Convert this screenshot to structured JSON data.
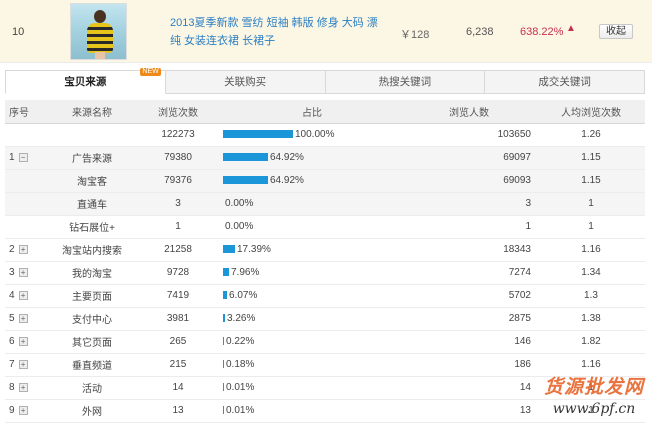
{
  "product": {
    "rank": "10",
    "title": "2013夏季新款 雪纺 短袖 韩版 修身 大码 漂纯 女装连衣裙 长裙子",
    "price": "￥128",
    "visits": "6,238",
    "rate": "638.22%",
    "collapse_label": "收起"
  },
  "tabs": [
    {
      "label": "宝贝来源",
      "badge": "NEW"
    },
    {
      "label": "关联购买"
    },
    {
      "label": "热搜关键词"
    },
    {
      "label": "成交关键词"
    }
  ],
  "table": {
    "headers": [
      "序号",
      "来源名称",
      "浏览次数",
      "占比",
      "浏览人数",
      "人均浏览次数"
    ],
    "rows": [
      {
        "idx": "",
        "toggle": "",
        "name": "",
        "pv": "122273",
        "ratio": 100.0,
        "pct": "100.00%",
        "uv": "103650",
        "avg": "1.26"
      },
      {
        "idx": "1",
        "toggle": "−",
        "name": "广告来源",
        "pv": "79380",
        "ratio": 64.92,
        "pct": "64.92%",
        "uv": "69097",
        "avg": "1.15"
      },
      {
        "idx": "",
        "toggle": "",
        "name": "淘宝客",
        "pv": "79376",
        "ratio": 64.92,
        "pct": "64.92%",
        "uv": "69093",
        "avg": "1.15"
      },
      {
        "idx": "",
        "toggle": "",
        "name": "直通车",
        "pv": "3",
        "ratio": 0.0,
        "pct": "0.00%",
        "uv": "3",
        "avg": "1"
      },
      {
        "idx": "",
        "toggle": "",
        "name": "钻石展位+",
        "pv": "1",
        "ratio": 0.0,
        "pct": "0.00%",
        "uv": "1",
        "avg": "1"
      },
      {
        "idx": "2",
        "toggle": "+",
        "name": "淘宝站内搜索",
        "pv": "21258",
        "ratio": 17.39,
        "pct": "17.39%",
        "uv": "18343",
        "avg": "1.16"
      },
      {
        "idx": "3",
        "toggle": "+",
        "name": "我的淘宝",
        "pv": "9728",
        "ratio": 7.96,
        "pct": "7.96%",
        "uv": "7274",
        "avg": "1.34"
      },
      {
        "idx": "4",
        "toggle": "+",
        "name": "主要页面",
        "pv": "7419",
        "ratio": 6.07,
        "pct": "6.07%",
        "uv": "5702",
        "avg": "1.3"
      },
      {
        "idx": "5",
        "toggle": "+",
        "name": "支付中心",
        "pv": "3981",
        "ratio": 3.26,
        "pct": "3.26%",
        "uv": "2875",
        "avg": "1.38"
      },
      {
        "idx": "6",
        "toggle": "+",
        "name": "其它页面",
        "pv": "265",
        "ratio": 0.22,
        "pct": "0.22%",
        "uv": "146",
        "avg": "1.82"
      },
      {
        "idx": "7",
        "toggle": "+",
        "name": "垂直频道",
        "pv": "215",
        "ratio": 0.18,
        "pct": "0.18%",
        "uv": "186",
        "avg": "1.16"
      },
      {
        "idx": "8",
        "toggle": "+",
        "name": "活动",
        "pv": "14",
        "ratio": 0.01,
        "pct": "0.01%",
        "uv": "14",
        "avg": "1"
      },
      {
        "idx": "9",
        "toggle": "+",
        "name": "外网",
        "pv": "13",
        "ratio": 0.01,
        "pct": "0.01%",
        "uv": "13",
        "avg": "1"
      }
    ]
  },
  "watermark": {
    "cn": "货源批发网",
    "url": "www.6pf.cn"
  },
  "colors": {
    "bar": "#1b97d9",
    "link": "#2b7fc3",
    "rate_up": "#c8304a",
    "product_bg": "#fcf6e4"
  }
}
